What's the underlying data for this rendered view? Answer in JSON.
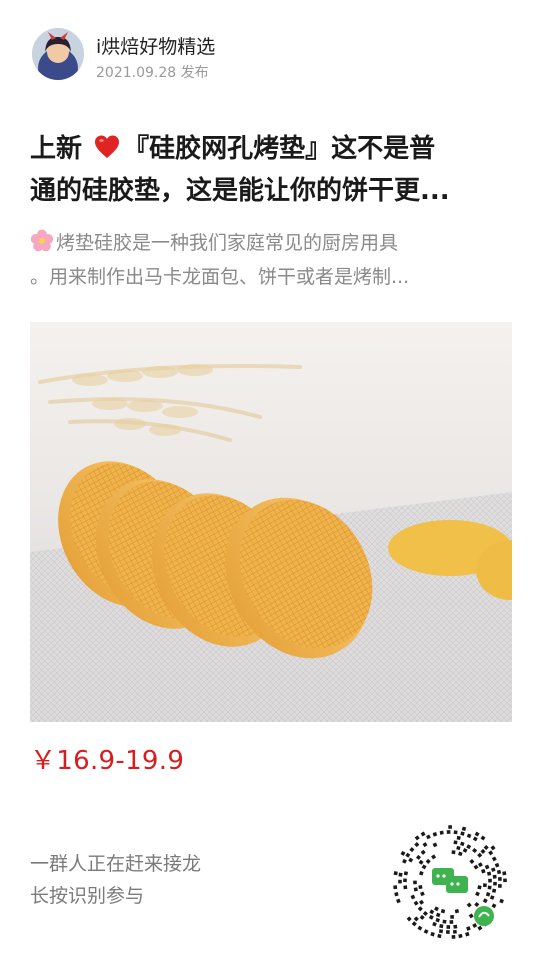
{
  "header": {
    "account_name": "i烘焙好物精选",
    "post_date": "2021.09.28 发布"
  },
  "post": {
    "title_line1_prefix": "上新 ",
    "title_line1_suffix": "『硅胶网孔烤垫』这不是普",
    "title_line2": "通的硅胶垫，这是能让你的饼干更...",
    "desc_line1": "烤垫硅胶是一种我们家庭常见的厨房用具",
    "desc_line2": "。用来制作出马卡龙面包、饼干或者是烤制..."
  },
  "product": {
    "price": "￥16.9-19.9",
    "price_color": "#d71e1e"
  },
  "footer": {
    "line1": "一群人正在赶来接龙",
    "line2": "长按识别参与"
  },
  "icons": {
    "heart": "heart-icon",
    "flower": "flower-icon",
    "qr": "qr-code",
    "mini_program": "mini-program-icon"
  }
}
